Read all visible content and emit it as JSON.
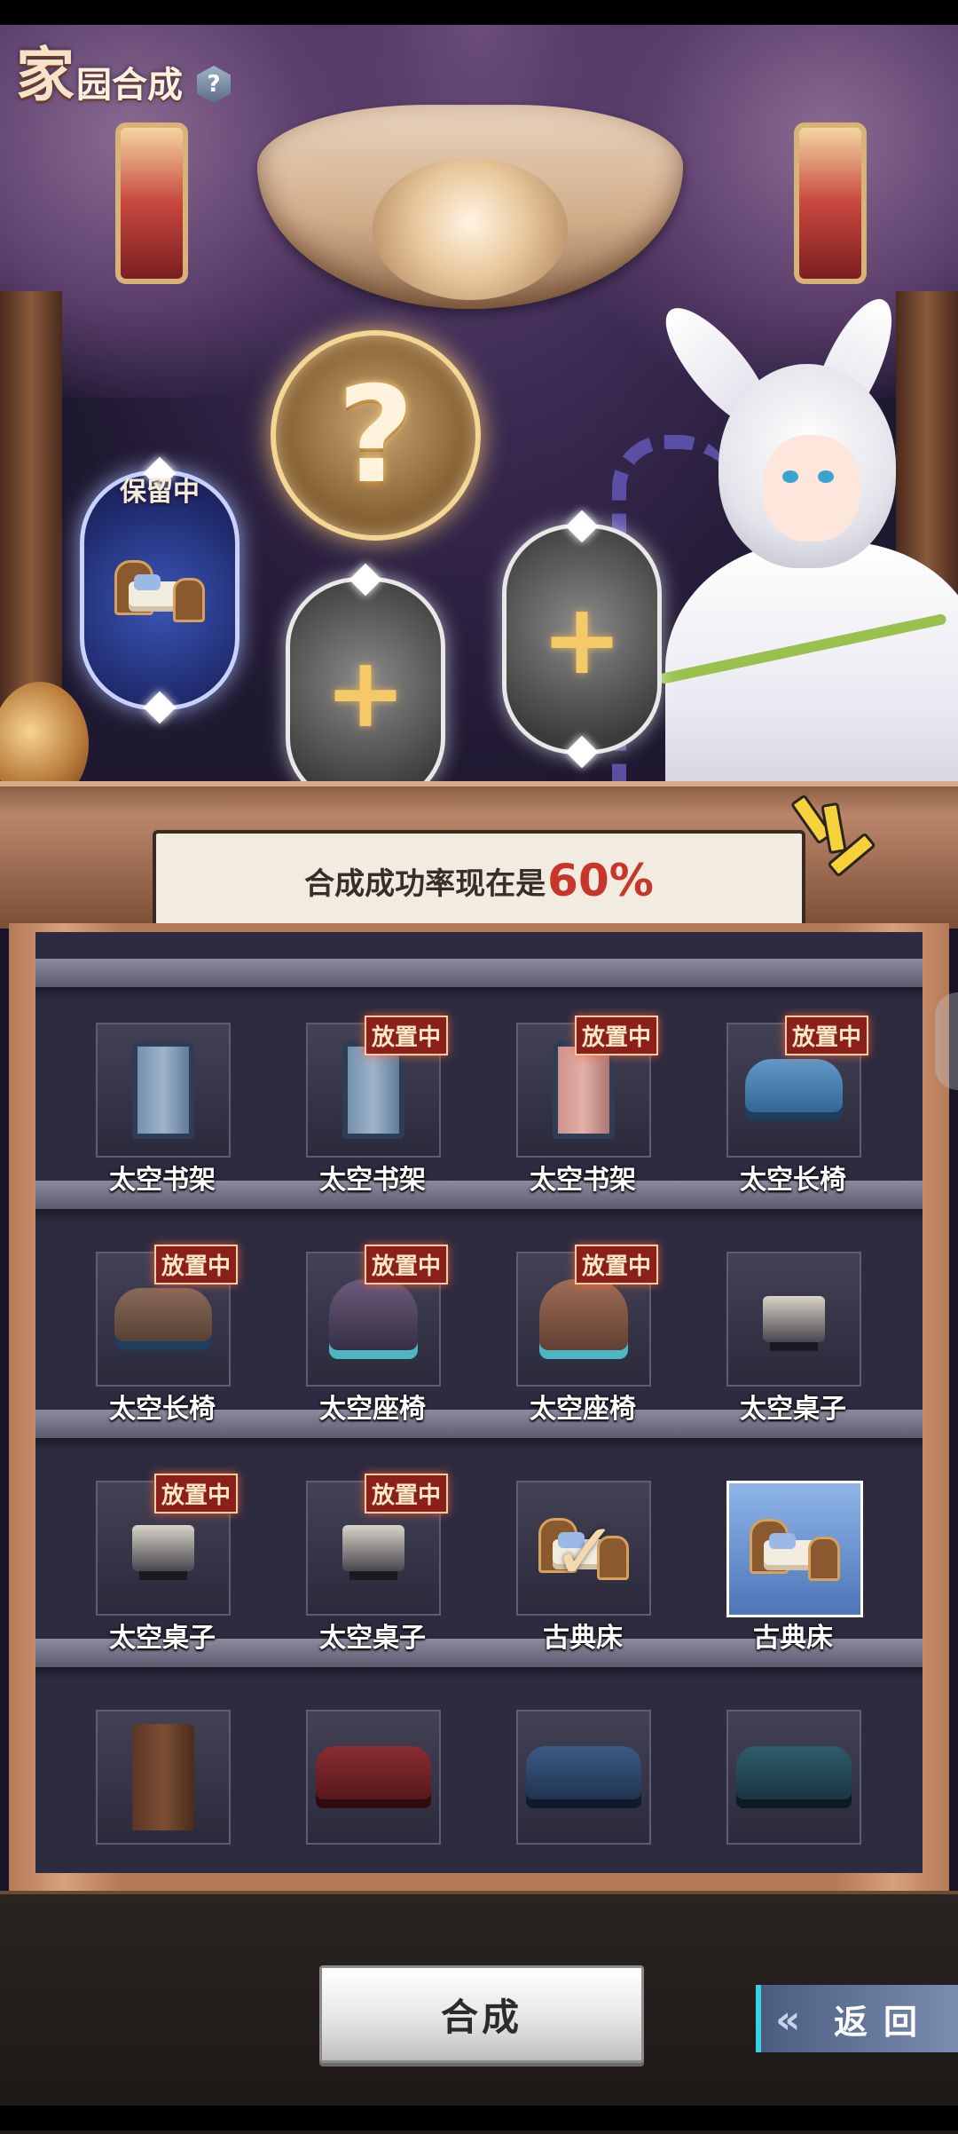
{
  "title": {
    "big_char": "家",
    "rest": "园合成",
    "help_icon": "?"
  },
  "synthesis": {
    "kept_label": "保留中",
    "mystery_symbol": "?",
    "plus_symbol": "+"
  },
  "success": {
    "text": "合成成功率现在是",
    "rate": "60%"
  },
  "tag_text": "放置中",
  "items": [
    {
      "label": "太空书架",
      "placed": false,
      "shape": "shelf"
    },
    {
      "label": "太空书架",
      "placed": true,
      "shape": "shelf"
    },
    {
      "label": "太空书架",
      "placed": true,
      "shape": "shelf-pink"
    },
    {
      "label": "太空长椅",
      "placed": true,
      "shape": "bench"
    },
    {
      "label": "太空长椅",
      "placed": true,
      "shape": "bench-warm"
    },
    {
      "label": "太空座椅",
      "placed": true,
      "shape": "chair"
    },
    {
      "label": "太空座椅",
      "placed": true,
      "shape": "chair-warm"
    },
    {
      "label": "太空桌子",
      "placed": false,
      "shape": "table"
    },
    {
      "label": "太空桌子",
      "placed": true,
      "shape": "table"
    },
    {
      "label": "太空桌子",
      "placed": true,
      "shape": "table"
    },
    {
      "label": "古典床",
      "placed": false,
      "shape": "bed",
      "checked": true
    },
    {
      "label": "古典床",
      "placed": false,
      "shape": "bed",
      "selected": true
    },
    {
      "label": "",
      "placed": false,
      "shape": "wardrobe"
    },
    {
      "label": "",
      "placed": false,
      "shape": "sofa-red"
    },
    {
      "label": "",
      "placed": false,
      "shape": "sofa-blue"
    },
    {
      "label": "",
      "placed": false,
      "shape": "sofa-teal"
    }
  ],
  "buttons": {
    "craft": "合成",
    "back": "返回",
    "back_arrows": "«"
  },
  "colors": {
    "rate_red": "#c8352a",
    "back_accent": "#37d3de",
    "tag_bg": "#8b1f1a"
  }
}
